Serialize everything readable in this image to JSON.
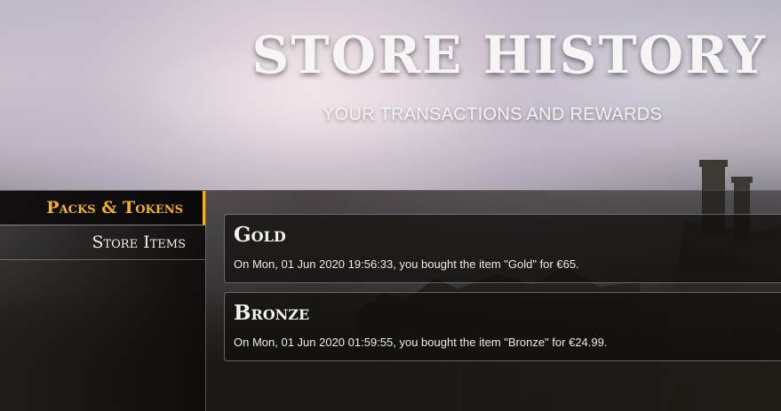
{
  "header": {
    "title": "STORE HISTORY",
    "subtitle": "YOUR TRANSACTIONS AND REWARDS"
  },
  "sidebar": {
    "tabs": [
      {
        "label": "Packs & Tokens",
        "active": true
      },
      {
        "label": "Store Items",
        "active": false
      }
    ]
  },
  "transactions": [
    {
      "name": "Gold",
      "description": "On Mon, 01 Jun 2020 19:56:33, you bought the item \"Gold\" for €65."
    },
    {
      "name": "Bronze",
      "description": "On Mon, 01 Jun 2020 01:59:55, you bought the item \"Bronze\" for €24.99."
    }
  ],
  "colors": {
    "accent": "#f0b22a",
    "text": "#f5f2f0"
  }
}
